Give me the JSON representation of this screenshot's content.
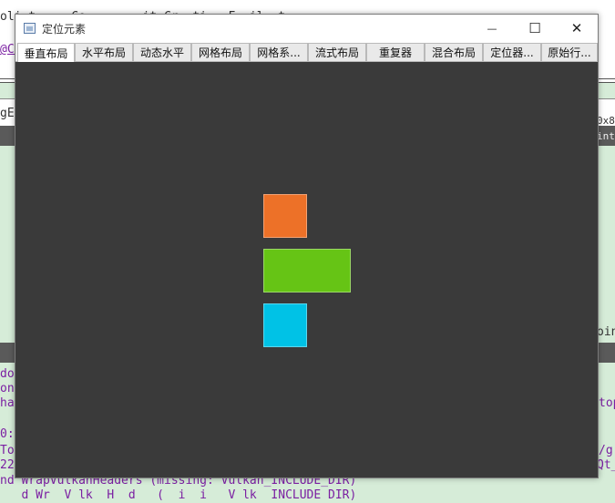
{
  "background_editor": {
    "top_lines": [
      "oli_t_ _  Ce    _ _ it Cr  ti _ F  il _t",
      "@Co"
    ],
    "left_snippets": [
      "gEle",
      "do",
      "on",
      "ha",
      "0:",
      "To",
      "22"
    ],
    "right_snippets": [
      "0x8",
      "ints",
      "oin",
      "top",
      "/g",
      "Qt_"
    ],
    "bottom_lines": [
      "nd WrapVulkanHeaders (missing: Vulkan_INCLUDE_DIR)",
      "   d Wr  V lk  H  d   (  i  i   V lk  INCLUDE DIR)"
    ]
  },
  "window": {
    "title": "定位元素",
    "minimize_symbol": "—",
    "maximize_symbol": "☐",
    "close_symbol": "✕",
    "tabs": [
      {
        "label": "垂直布局",
        "active": true
      },
      {
        "label": "水平布局",
        "active": false
      },
      {
        "label": "动态水平",
        "active": false
      },
      {
        "label": "网格布局",
        "active": false
      },
      {
        "label": "网格系...",
        "active": false
      },
      {
        "label": "流式布局",
        "active": false
      },
      {
        "label": "重复器",
        "active": false
      },
      {
        "label": "混合布局",
        "active": false
      },
      {
        "label": "定位器...",
        "active": false
      },
      {
        "label": "原始行...",
        "active": false
      }
    ],
    "content": {
      "background": "#3a3a3a",
      "rectangles": [
        {
          "name": "orange-rect",
          "color": "#ed7128"
        },
        {
          "name": "green-rect",
          "color": "#66c415"
        },
        {
          "name": "cyan-rect",
          "color": "#00c2e6"
        }
      ]
    }
  }
}
